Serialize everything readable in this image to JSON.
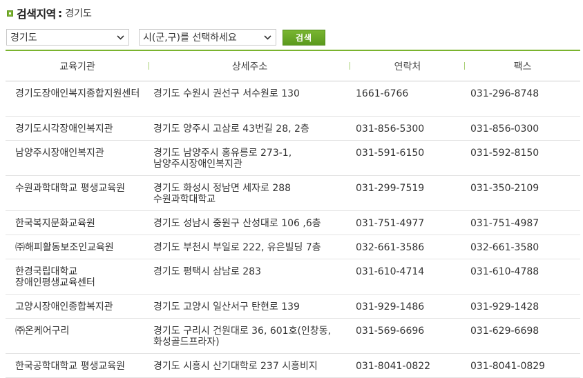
{
  "header": {
    "title": "검색지역",
    "colon": ":",
    "region": "경기도"
  },
  "filters": {
    "province_value": "경기도",
    "city_placeholder": "시(군,구)를 선택하세요",
    "search_label": "검색"
  },
  "colors": {
    "accent": "#7ab32e",
    "button": "#5b9a1e",
    "divider": "#a8cf74"
  },
  "table": {
    "columns": [
      "교육기관",
      "상세주소",
      "연락처",
      "팩스"
    ],
    "rows": [
      {
        "name": "경기도장애인복지종합지원센터",
        "address": "경기도 수원시 권선구 서수원로 130",
        "phone": "1661-6766",
        "fax": "031-296-8748"
      },
      {
        "name": "경기도시각장애인복지관",
        "address": "경기도 양주시 고삼로 43번길 28, 2층",
        "phone": "031-856-5300",
        "fax": "031-856-0300"
      },
      {
        "name": "남양주시장애인복지관",
        "address": "경기도 남양주시 홍유릉로 273-1, 남양주시장애인복지관",
        "phone": "031-591-6150",
        "fax": "031-592-8150"
      },
      {
        "name": "수원과학대학교 평생교육원",
        "address": "경기도 화성시 정남면 세자로 288 수원과학대학교",
        "phone": "031-299-7519",
        "fax": "031-350-2109"
      },
      {
        "name": "한국복지문화교육원",
        "address": "경기도 성남시 중원구 산성대로 106 ,6층",
        "phone": "031-751-4977",
        "fax": "031-751-4987"
      },
      {
        "name": "㈜해피활동보조인교육원",
        "address": "경기도 부천시 부일로 222, 유은빌딩 7층",
        "phone": "032-661-3586",
        "fax": "032-661-3580"
      },
      {
        "name": "한경국립대학교 장애인평생교육센터",
        "address": "경기도 평택시 삼남로 283",
        "phone": "031-610-4714",
        "fax": "031-610-4788"
      },
      {
        "name": "고양시장애인종합복지관",
        "address": "경기도 고양시 일산서구 탄현로 139",
        "phone": "031-929-1486",
        "fax": "031-929-1428"
      },
      {
        "name": "㈜온케어구리",
        "address": "경기도 구리시 건원대로 36, 601호(인창동,화성골드프라자)",
        "phone": "031-569-6696",
        "fax": "031-629-6698"
      },
      {
        "name": "한국공학대학교 평생교육원",
        "address": "경기도 시흥시 산기대학로 237 시흥비지",
        "phone": "031-8041-0822",
        "fax": "031-8041-0829"
      }
    ]
  }
}
